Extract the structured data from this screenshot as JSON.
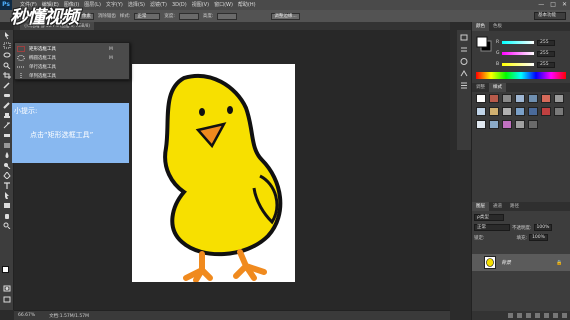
{
  "app": {
    "logo": "Ps",
    "menus": [
      "文件(F)",
      "编辑(E)",
      "图像(I)",
      "图层(L)",
      "文字(Y)",
      "选择(S)",
      "滤镜(T)",
      "3D(D)",
      "视图(V)",
      "窗口(W)",
      "帮助(H)"
    ],
    "window_controls": [
      "—",
      "□",
      "✕"
    ]
  },
  "watermark": "秒懂视频",
  "options": {
    "feather_label": "羽化:",
    "feather_value": "0 像素",
    "antialias_label": "消除锯齿",
    "style_label": "样式:",
    "style_value": "正常",
    "width_label": "宽度:",
    "height_label": "高度:",
    "refine_label": "调整边缘...",
    "workspace": "基本功能"
  },
  "document": {
    "tab": "小鸡.jpg @ 66.7% (图层 0, RGB/8)"
  },
  "flyout": {
    "items": [
      {
        "label": "矩形选框工具",
        "key": "M"
      },
      {
        "label": "椭圆选框工具",
        "key": "M"
      },
      {
        "label": "单行选框工具",
        "key": ""
      },
      {
        "label": "单列选框工具",
        "key": ""
      }
    ]
  },
  "hint": {
    "title": "小提示:",
    "text": "点击“矩形选框工具”"
  },
  "status": {
    "zoom": "66.67%",
    "doc": "文档:1.57M/1.57M"
  },
  "color_panel": {
    "tabs": [
      "颜色",
      "色板"
    ],
    "r_label": "R",
    "g_label": "G",
    "b_label": "B",
    "r": "255",
    "g": "255",
    "b": "255"
  },
  "styles_panel": {
    "tabs": [
      "调整",
      "样式"
    ]
  },
  "layers_panel": {
    "tabs": [
      "图层",
      "通道",
      "路径"
    ],
    "kind_label": "ρ类型",
    "blend_mode": "正常",
    "opacity_label": "不透明度:",
    "opacity_value": "100%",
    "lock_label": "锁定:",
    "fill_label": "填充:",
    "fill_value": "100%",
    "layer_name": "背景"
  },
  "colors": {
    "chick_body": "#f7e000",
    "chick_beak": "#f08a1e",
    "hint_bg": "#88b8f0",
    "accent": "#4fb0ff"
  }
}
